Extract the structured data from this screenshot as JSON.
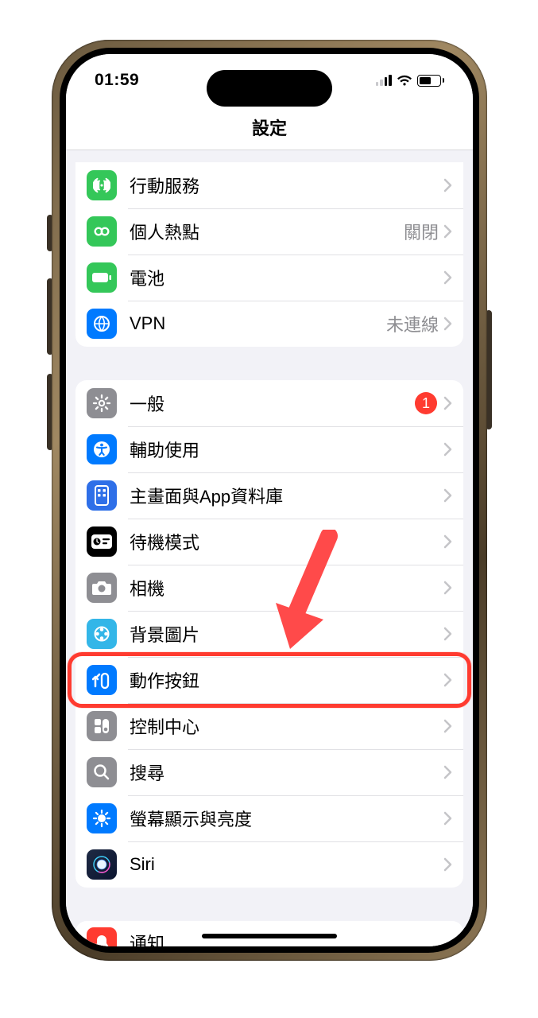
{
  "status": {
    "time": "01:59"
  },
  "nav": {
    "title": "設定"
  },
  "groups": [
    {
      "rows": [
        {
          "icon": "cellular-icon",
          "label": "行動服務",
          "value": ""
        },
        {
          "icon": "hotspot-icon",
          "label": "個人熱點",
          "value": "關閉"
        },
        {
          "icon": "battery-icon",
          "label": "電池",
          "value": ""
        },
        {
          "icon": "vpn-icon",
          "label": "VPN",
          "value": "未連線"
        }
      ]
    },
    {
      "rows": [
        {
          "icon": "general-icon",
          "label": "一般",
          "badge": "1"
        },
        {
          "icon": "accessibility-icon",
          "label": "輔助使用"
        },
        {
          "icon": "homescreen-icon",
          "label": "主畫面與App資料庫"
        },
        {
          "icon": "standby-icon",
          "label": "待機模式"
        },
        {
          "icon": "camera-icon",
          "label": "相機"
        },
        {
          "icon": "wallpaper-icon",
          "label": "背景圖片"
        },
        {
          "icon": "action-button-icon",
          "label": "動作按鈕"
        },
        {
          "icon": "control-center-icon",
          "label": "控制中心"
        },
        {
          "icon": "search-icon",
          "label": "搜尋"
        },
        {
          "icon": "display-icon",
          "label": "螢幕顯示與亮度"
        },
        {
          "icon": "siri-icon",
          "label": "Siri"
        }
      ]
    },
    {
      "rows": [
        {
          "icon": "notifications-icon",
          "label": "通知"
        }
      ]
    }
  ],
  "highlight_row_label": "動作按鈕"
}
